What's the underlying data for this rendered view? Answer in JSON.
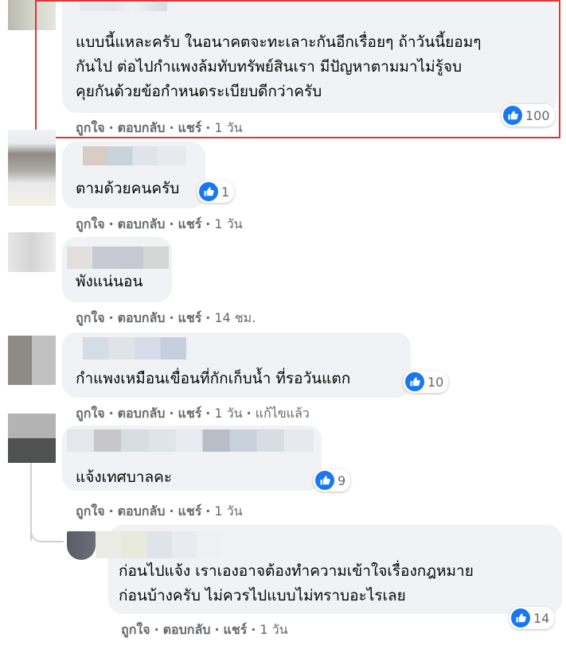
{
  "actions": {
    "like": "ถูกใจ",
    "reply": "ตอบกลับ",
    "share": "แชร์",
    "edited": "แก้ไขแล้ว"
  },
  "comments": [
    {
      "lines": [
        "แบบนี้แหละครับ ในอนาคตจะทะเลาะกันอีกเรื่อยๆ ถ้าวันนี้ยอมๆ",
        "กันไป ต่อไปกำแพงล้มทับทรัพย์สินเรา มีปัญหาตามมาไม่รู้จบ",
        "คุยกันด้วยข้อกำหนดระเบียบดีกว่าครับ"
      ],
      "time": "1 วัน",
      "reactions": "100"
    },
    {
      "lines": [
        "ตามด้วยคนครับ"
      ],
      "time": "1 วัน",
      "reactions": "1"
    },
    {
      "lines": [
        "พังแน่นอน"
      ],
      "time": "14 ชม."
    },
    {
      "lines": [
        "กำแพงเหมือนเขื่อนที่กักเก็บน้ำ ที่รอวันแตก"
      ],
      "time": "1 วัน",
      "reactions": "10"
    },
    {
      "lines": [
        "แจ้งเทศบาลคะ"
      ],
      "time": "1 วัน",
      "reactions": "9"
    },
    {
      "lines": [
        "ก่อนไปแจ้ง เราเองอาจต้องทำความเข้าใจเรื่องกฎหมาย",
        "ก่อนบ้างครับ ไม่ควรไปแบบไม่ทราบอะไรเลย"
      ],
      "time": "1 วัน",
      "reactions": "14"
    }
  ],
  "colors": {
    "highlight": "#e03535",
    "like": "#1877f2",
    "bubble": "#f0f2f5"
  },
  "icons": {
    "reaction": "like-thumbs-up-icon"
  }
}
